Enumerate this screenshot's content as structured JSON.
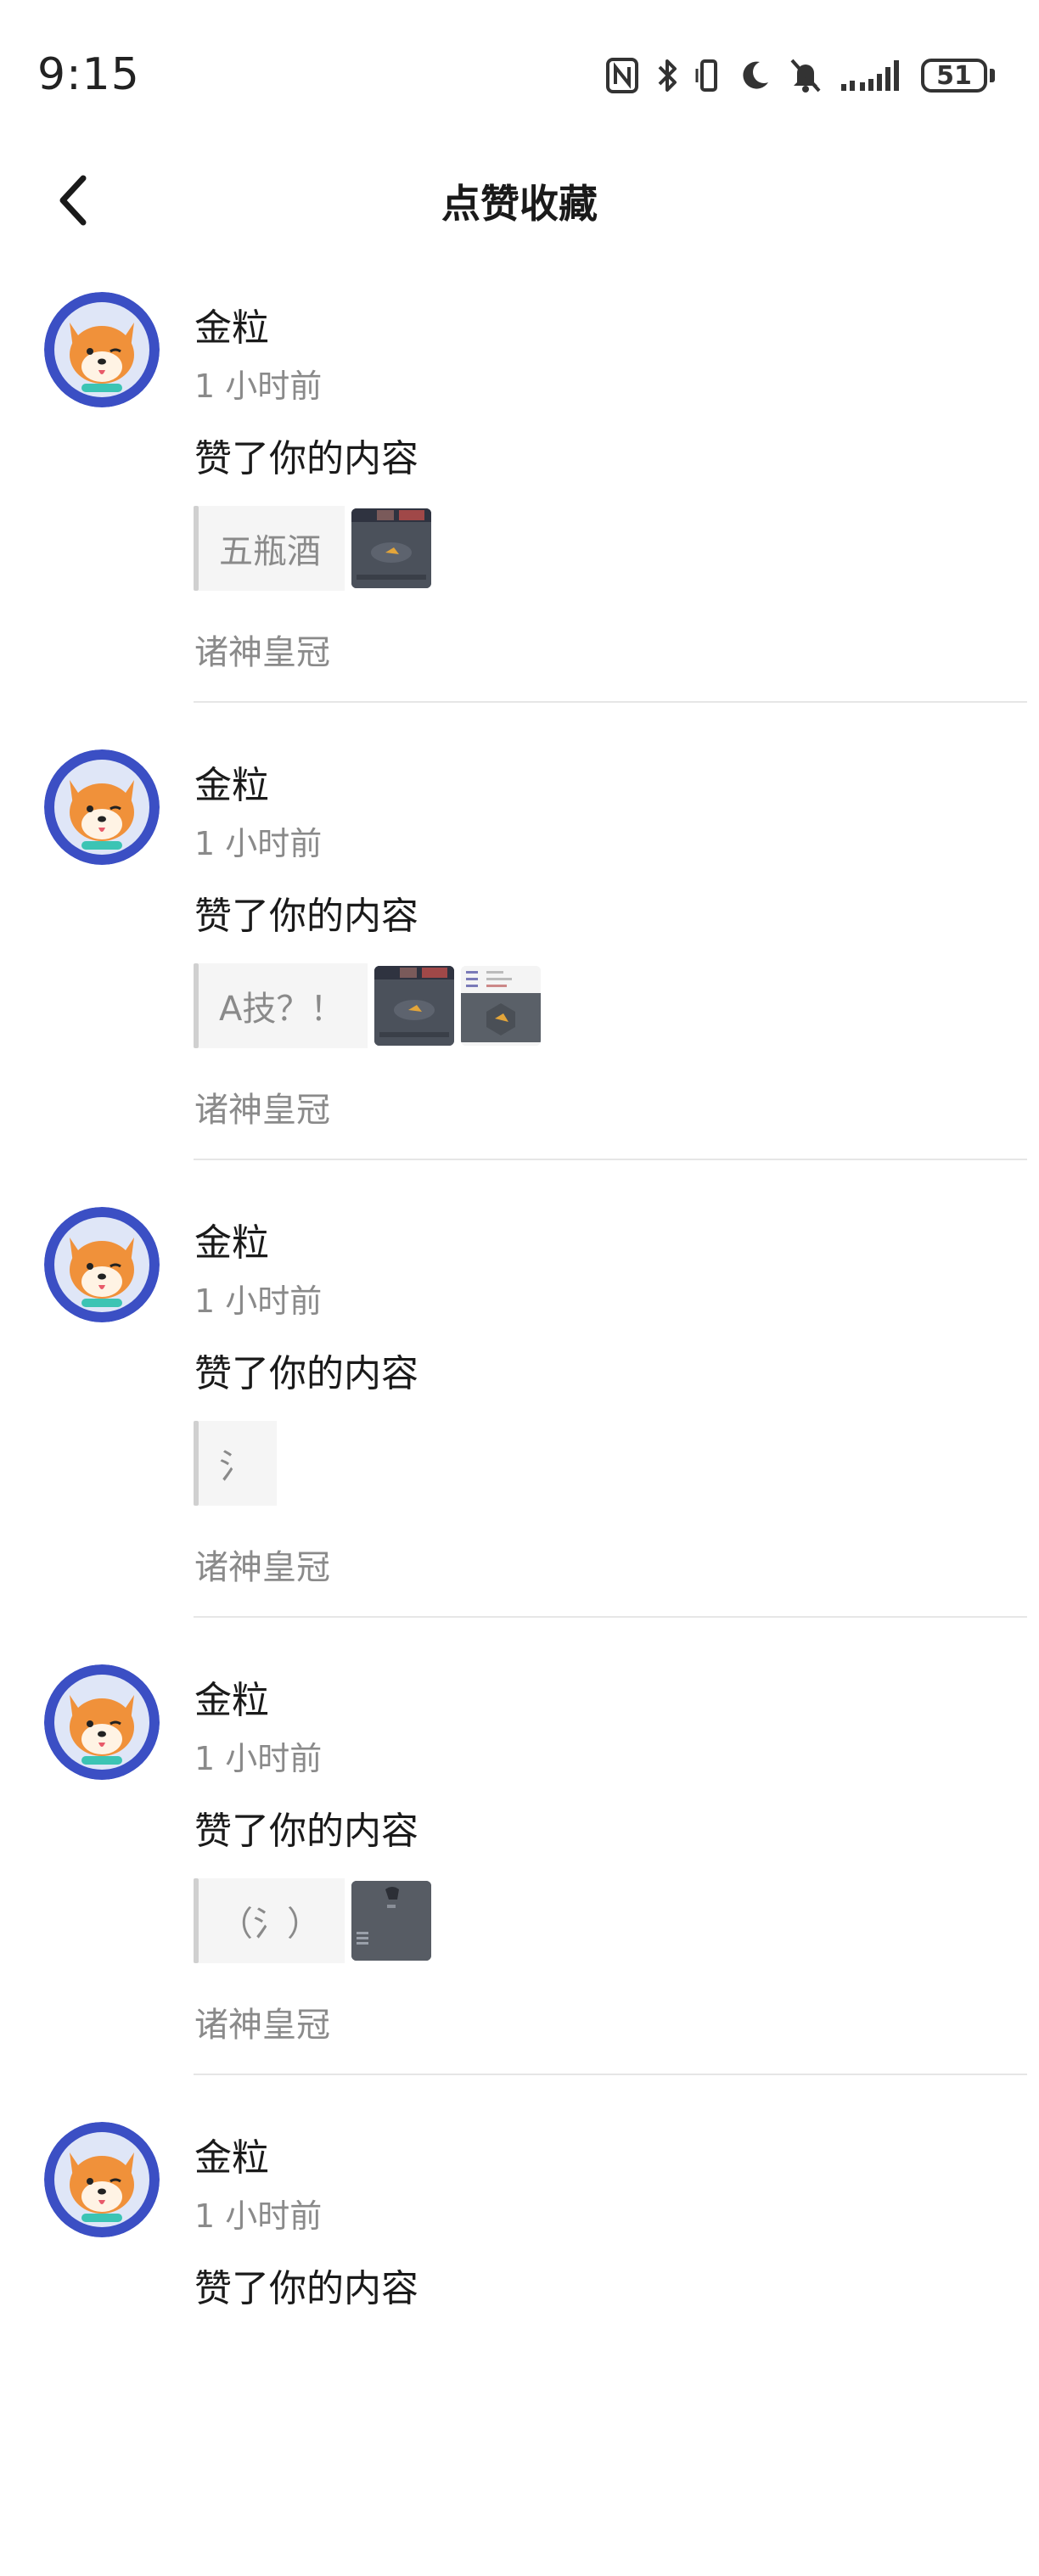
{
  "status_bar": {
    "time": "9:15",
    "battery": "51",
    "icons": [
      "nfc-icon",
      "bluetooth-icon",
      "vibrate-icon",
      "moon-icon",
      "bell-muted-icon",
      "signal-icon",
      "battery-icon"
    ]
  },
  "header": {
    "title": "点赞收藏",
    "back_icon": "chevron-left-icon"
  },
  "feed": [
    {
      "user": "金粒",
      "time": "1 小时前",
      "action": "赞了你的内容",
      "snippet": "五瓶酒",
      "thumbnails": [
        "dark"
      ],
      "game": "诸神皇冠"
    },
    {
      "user": "金粒",
      "time": "1 小时前",
      "action": "赞了你的内容",
      "snippet": "A技？！",
      "thumbnails": [
        "dark",
        "light"
      ],
      "game": "诸神皇冠"
    },
    {
      "user": "金粒",
      "time": "1 小时前",
      "action": "赞了你的内容",
      "snippet": "氵",
      "thumbnails": [],
      "game": "诸神皇冠"
    },
    {
      "user": "金粒",
      "time": "1 小时前",
      "action": "赞了你的内容",
      "snippet": "（氵）",
      "thumbnails": [
        "dark"
      ],
      "game": "诸神皇冠"
    },
    {
      "user": "金粒",
      "time": "1 小时前",
      "action": "赞了你的内容",
      "snippet": "",
      "thumbnails": [],
      "game": ""
    }
  ],
  "colors": {
    "text_primary": "#1a1a1a",
    "text_secondary": "#8a8a8a",
    "divider": "#e6e6e6",
    "avatar_ring": "#3b4fc4",
    "shiba_orange": "#f0913a"
  }
}
